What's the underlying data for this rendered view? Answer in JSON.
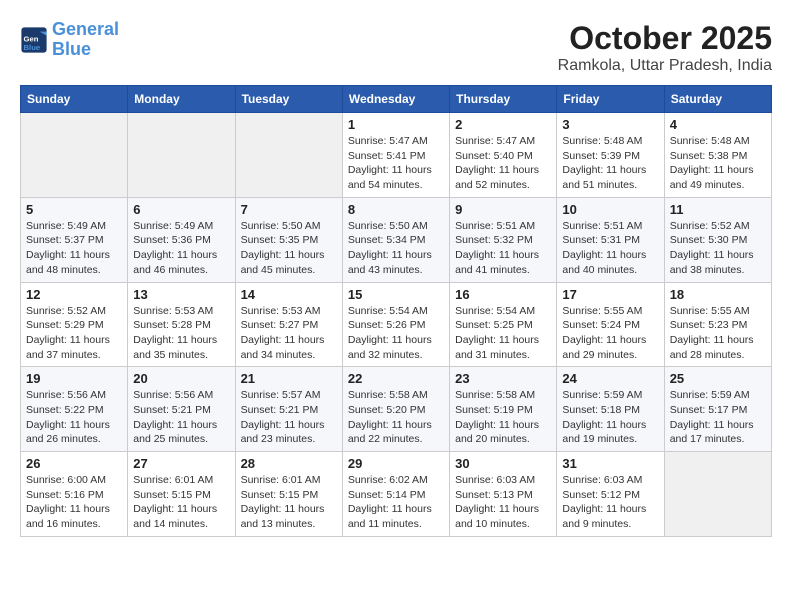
{
  "header": {
    "logo_line1": "General",
    "logo_line2": "Blue",
    "title": "October 2025",
    "subtitle": "Ramkola, Uttar Pradesh, India"
  },
  "weekdays": [
    "Sunday",
    "Monday",
    "Tuesday",
    "Wednesday",
    "Thursday",
    "Friday",
    "Saturday"
  ],
  "weeks": [
    [
      {
        "day": "",
        "info": ""
      },
      {
        "day": "",
        "info": ""
      },
      {
        "day": "",
        "info": ""
      },
      {
        "day": "1",
        "info": "Sunrise: 5:47 AM\nSunset: 5:41 PM\nDaylight: 11 hours\nand 54 minutes."
      },
      {
        "day": "2",
        "info": "Sunrise: 5:47 AM\nSunset: 5:40 PM\nDaylight: 11 hours\nand 52 minutes."
      },
      {
        "day": "3",
        "info": "Sunrise: 5:48 AM\nSunset: 5:39 PM\nDaylight: 11 hours\nand 51 minutes."
      },
      {
        "day": "4",
        "info": "Sunrise: 5:48 AM\nSunset: 5:38 PM\nDaylight: 11 hours\nand 49 minutes."
      }
    ],
    [
      {
        "day": "5",
        "info": "Sunrise: 5:49 AM\nSunset: 5:37 PM\nDaylight: 11 hours\nand 48 minutes."
      },
      {
        "day": "6",
        "info": "Sunrise: 5:49 AM\nSunset: 5:36 PM\nDaylight: 11 hours\nand 46 minutes."
      },
      {
        "day": "7",
        "info": "Sunrise: 5:50 AM\nSunset: 5:35 PM\nDaylight: 11 hours\nand 45 minutes."
      },
      {
        "day": "8",
        "info": "Sunrise: 5:50 AM\nSunset: 5:34 PM\nDaylight: 11 hours\nand 43 minutes."
      },
      {
        "day": "9",
        "info": "Sunrise: 5:51 AM\nSunset: 5:32 PM\nDaylight: 11 hours\nand 41 minutes."
      },
      {
        "day": "10",
        "info": "Sunrise: 5:51 AM\nSunset: 5:31 PM\nDaylight: 11 hours\nand 40 minutes."
      },
      {
        "day": "11",
        "info": "Sunrise: 5:52 AM\nSunset: 5:30 PM\nDaylight: 11 hours\nand 38 minutes."
      }
    ],
    [
      {
        "day": "12",
        "info": "Sunrise: 5:52 AM\nSunset: 5:29 PM\nDaylight: 11 hours\nand 37 minutes."
      },
      {
        "day": "13",
        "info": "Sunrise: 5:53 AM\nSunset: 5:28 PM\nDaylight: 11 hours\nand 35 minutes."
      },
      {
        "day": "14",
        "info": "Sunrise: 5:53 AM\nSunset: 5:27 PM\nDaylight: 11 hours\nand 34 minutes."
      },
      {
        "day": "15",
        "info": "Sunrise: 5:54 AM\nSunset: 5:26 PM\nDaylight: 11 hours\nand 32 minutes."
      },
      {
        "day": "16",
        "info": "Sunrise: 5:54 AM\nSunset: 5:25 PM\nDaylight: 11 hours\nand 31 minutes."
      },
      {
        "day": "17",
        "info": "Sunrise: 5:55 AM\nSunset: 5:24 PM\nDaylight: 11 hours\nand 29 minutes."
      },
      {
        "day": "18",
        "info": "Sunrise: 5:55 AM\nSunset: 5:23 PM\nDaylight: 11 hours\nand 28 minutes."
      }
    ],
    [
      {
        "day": "19",
        "info": "Sunrise: 5:56 AM\nSunset: 5:22 PM\nDaylight: 11 hours\nand 26 minutes."
      },
      {
        "day": "20",
        "info": "Sunrise: 5:56 AM\nSunset: 5:21 PM\nDaylight: 11 hours\nand 25 minutes."
      },
      {
        "day": "21",
        "info": "Sunrise: 5:57 AM\nSunset: 5:21 PM\nDaylight: 11 hours\nand 23 minutes."
      },
      {
        "day": "22",
        "info": "Sunrise: 5:58 AM\nSunset: 5:20 PM\nDaylight: 11 hours\nand 22 minutes."
      },
      {
        "day": "23",
        "info": "Sunrise: 5:58 AM\nSunset: 5:19 PM\nDaylight: 11 hours\nand 20 minutes."
      },
      {
        "day": "24",
        "info": "Sunrise: 5:59 AM\nSunset: 5:18 PM\nDaylight: 11 hours\nand 19 minutes."
      },
      {
        "day": "25",
        "info": "Sunrise: 5:59 AM\nSunset: 5:17 PM\nDaylight: 11 hours\nand 17 minutes."
      }
    ],
    [
      {
        "day": "26",
        "info": "Sunrise: 6:00 AM\nSunset: 5:16 PM\nDaylight: 11 hours\nand 16 minutes."
      },
      {
        "day": "27",
        "info": "Sunrise: 6:01 AM\nSunset: 5:15 PM\nDaylight: 11 hours\nand 14 minutes."
      },
      {
        "day": "28",
        "info": "Sunrise: 6:01 AM\nSunset: 5:15 PM\nDaylight: 11 hours\nand 13 minutes."
      },
      {
        "day": "29",
        "info": "Sunrise: 6:02 AM\nSunset: 5:14 PM\nDaylight: 11 hours\nand 11 minutes."
      },
      {
        "day": "30",
        "info": "Sunrise: 6:03 AM\nSunset: 5:13 PM\nDaylight: 11 hours\nand 10 minutes."
      },
      {
        "day": "31",
        "info": "Sunrise: 6:03 AM\nSunset: 5:12 PM\nDaylight: 11 hours\nand 9 minutes."
      },
      {
        "day": "",
        "info": ""
      }
    ]
  ]
}
